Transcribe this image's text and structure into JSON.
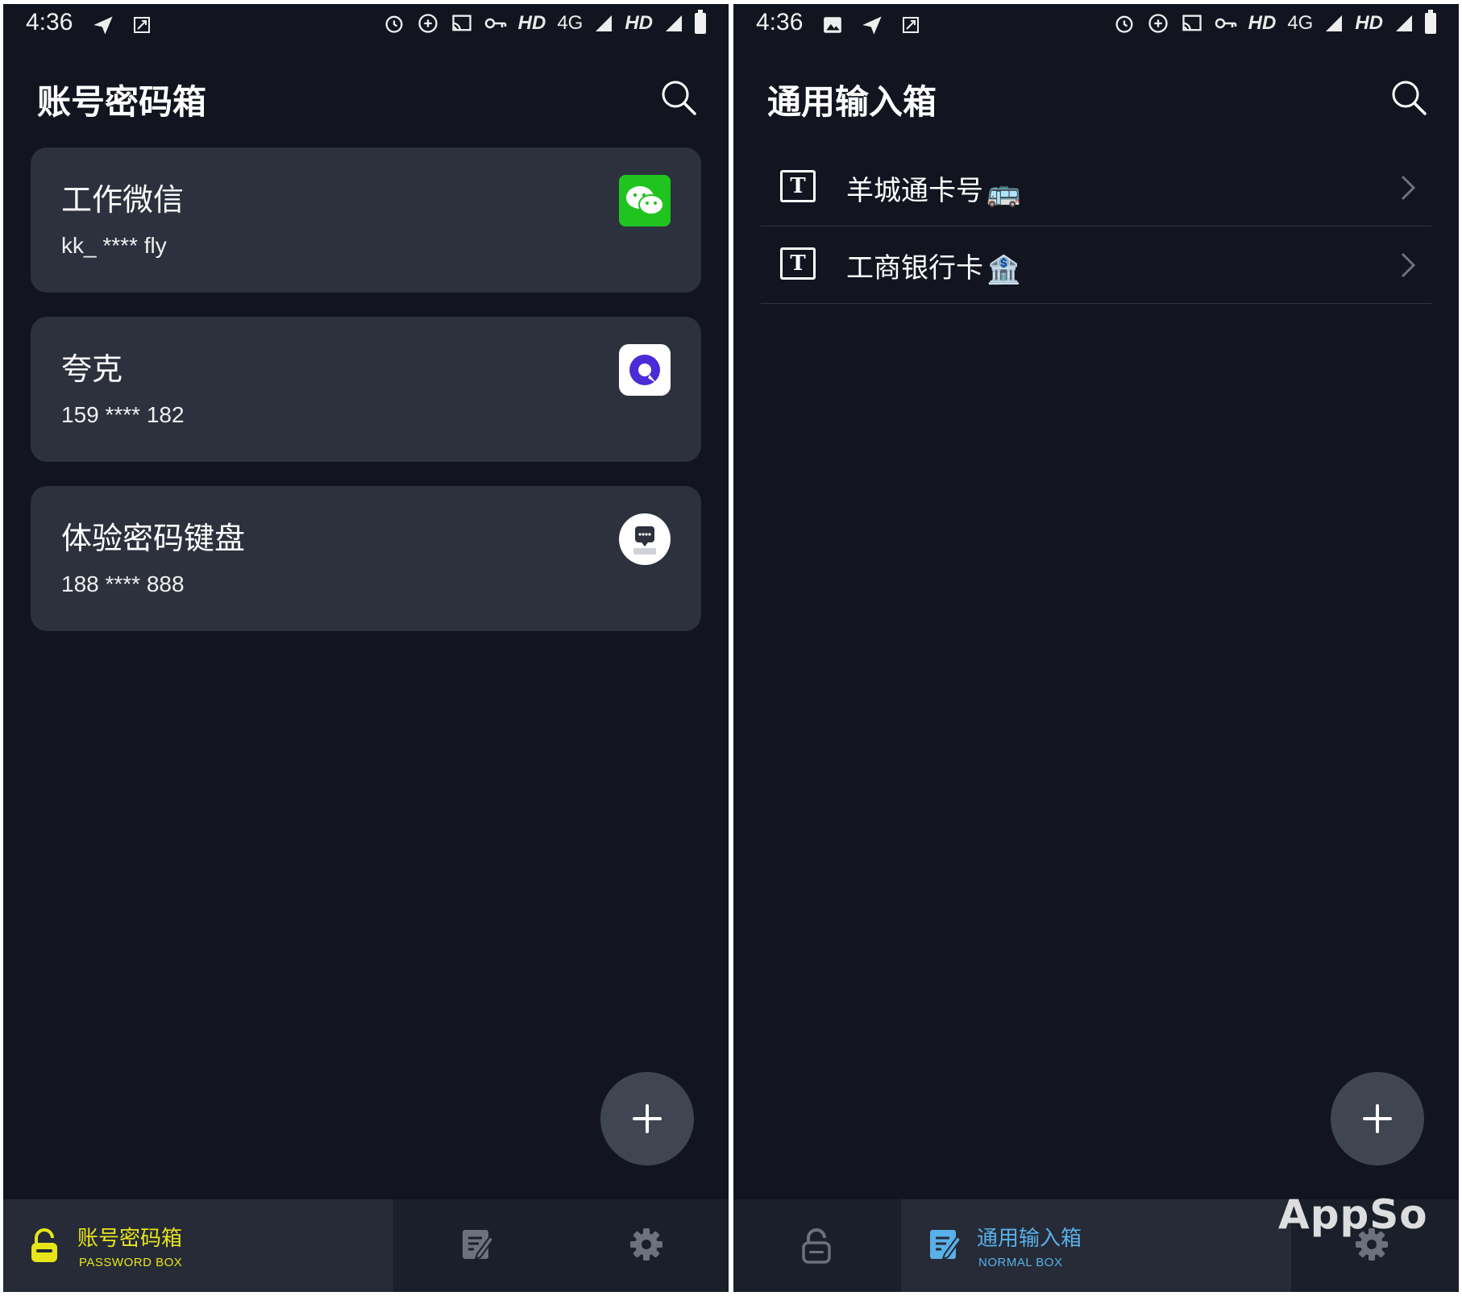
{
  "status_bar": {
    "time": "4:36",
    "hd1": "HD",
    "net": "4G",
    "hd2": "HD"
  },
  "left_screen": {
    "title": "账号密码箱",
    "accounts": [
      {
        "name": "工作微信",
        "account": "kk_ **** fly",
        "icon": "wechat-icon"
      },
      {
        "name": "夸克",
        "account": "159 **** 182",
        "icon": "quark-icon"
      },
      {
        "name": "体验密码键盘",
        "account": "188 **** 888",
        "icon": "password-keyboard-icon"
      }
    ],
    "nav": {
      "password_box_label": "账号密码箱",
      "password_box_sub": "PASSWORD BOX"
    }
  },
  "right_screen": {
    "title": "通用输入箱",
    "items": [
      {
        "label": "羊城通卡号",
        "emoji": "🚌",
        "icon": "text-box-icon"
      },
      {
        "label": "工商银行卡",
        "emoji": "🏦",
        "icon": "text-box-icon"
      }
    ],
    "item_icon_letter": "T",
    "nav": {
      "normal_box_label": "通用输入箱",
      "normal_box_sub": "NORMAL BOX"
    }
  },
  "fab_label": "+",
  "watermark": "AppSo",
  "colors": {
    "background": "#121520",
    "card": "#2c313d",
    "accent_yellow": "#e8e41a",
    "accent_blue": "#5ab0e8",
    "wechat_green": "#1fc41f",
    "quark_purple": "#4a2bd6"
  }
}
